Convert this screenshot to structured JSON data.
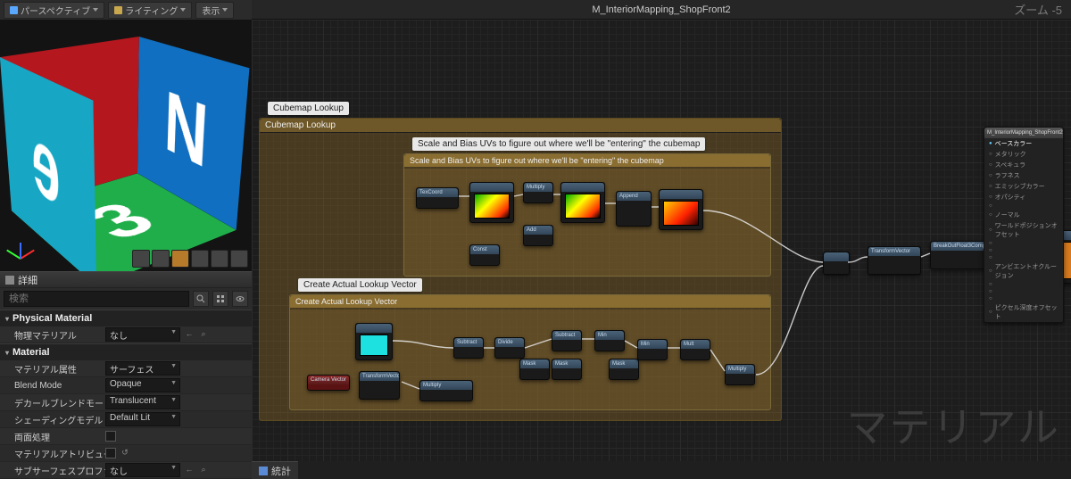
{
  "viewport": {
    "btn_perspective": "パースペクティブ",
    "btn_lighting": "ライティング",
    "btn_show": "表示"
  },
  "details": {
    "header": "詳細",
    "search_placeholder": "検索",
    "cat_phys": "Physical Material",
    "cat_material": "Material",
    "rows": {
      "phys_mat": {
        "label": "物理マテリアル",
        "value": "なし"
      },
      "mat_domain": {
        "label": "マテリアル属性",
        "value": "サーフェス"
      },
      "blend_mode": {
        "label": "Blend Mode",
        "value": "Opaque"
      },
      "decal_blend": {
        "label": "デカールブレンドモード",
        "value": "Translucent"
      },
      "shading_model": {
        "label": "シェーディングモデル",
        "value": "Default Lit"
      },
      "two_sided": {
        "label": "両面処理"
      },
      "mat_attr": {
        "label": "マテリアルアトリビュー"
      },
      "subsurface": {
        "label": "サブサーフェスプロファ",
        "value": "なし"
      }
    }
  },
  "graph": {
    "title": "M_InteriorMapping_ShopFront2",
    "zoom": "ズーム -5",
    "watermark": "マテリアル",
    "comment_main": "Cubemap Lookup",
    "comment_inner1": "Scale and Bias UVs to figure out where we'll be \"entering\" the cubemap",
    "comment_inner1_title": "Scale and Bias UVs to figure out where we'll be \"entering\" the cubemap",
    "comment_inner2": "Create Actual Lookup Vector",
    "comment_inner2_title": "Create Actual Lookup Vector",
    "result_node": {
      "title": "M_InteriorMapping_ShopFront2",
      "pins": [
        "ベースカラー",
        "メタリック",
        "スペキュラ",
        "ラフネス",
        "エミッシブカラー",
        "オパシティ",
        "",
        "ノーマル",
        "ワールドポジションオフセット",
        "",
        "",
        "",
        "アンビエントオクルージョン",
        "",
        "",
        "",
        "ピクセル深度オフセット"
      ]
    }
  },
  "stats": {
    "label": "統計"
  }
}
